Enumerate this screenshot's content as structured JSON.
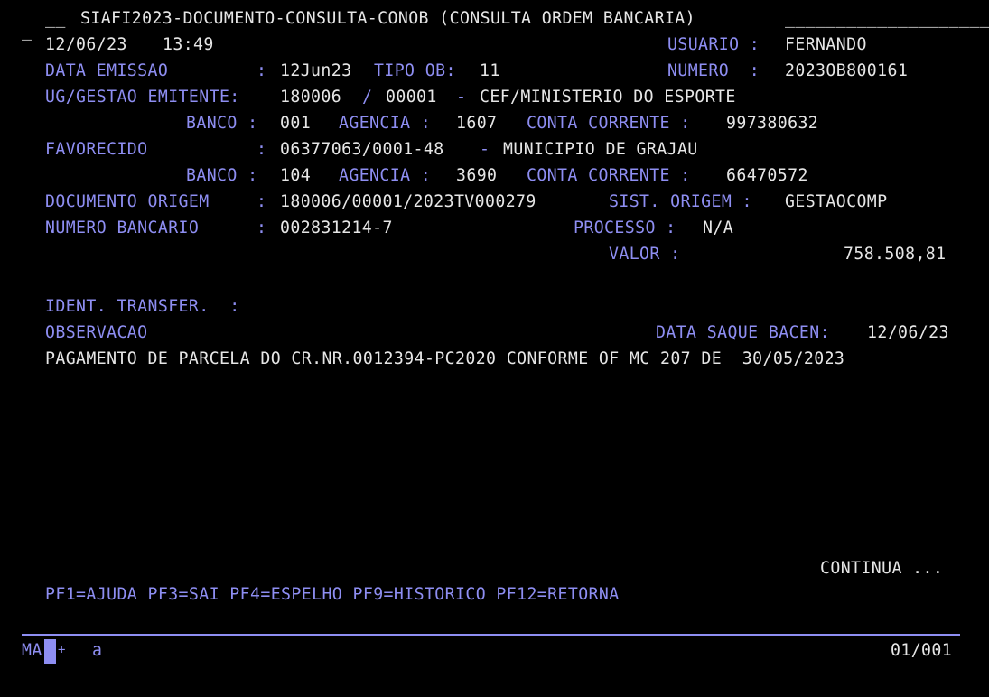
{
  "header": {
    "cursor_mark": "_",
    "prefix": "__",
    "title": "SIAFI2023-DOCUMENTO-CONSULTA-CONOB (CONSULTA ORDEM BANCARIA)",
    "fill": "____________________"
  },
  "session": {
    "date": "12/06/23",
    "time": "13:49",
    "usuario_label": "USUARIO :",
    "usuario_value": "FERNANDO"
  },
  "labels": {
    "data_emissao": "DATA EMISSAO",
    "colon": ":",
    "tipo_ob": "TIPO OB:",
    "numero": "NUMERO  :",
    "ug_gestao": "UG/GESTAO EMITENTE:",
    "slash": "/",
    "dash": "-",
    "banco": "BANCO :",
    "agencia": "AGENCIA :",
    "conta_corrente": "CONTA CORRENTE :",
    "favorecido": "FAVORECIDO",
    "documento_origem": "DOCUMENTO ORIGEM",
    "sist_origem": "SIST. ORIGEM :",
    "numero_bancario": "NUMERO BANCARIO",
    "processo": "PROCESSO :",
    "valor": "VALOR :",
    "ident_transfer": "IDENT. TRANSFER.  :",
    "observacao": "OBSERVACAO",
    "data_saque": "DATA SAQUE BACEN:"
  },
  "values": {
    "data_emissao": "12Jun23",
    "tipo_ob": "11",
    "numero": "2023OB800161",
    "ug": "180006",
    "gestao": "00001",
    "ug_nome": "CEF/MINISTERIO DO ESPORTE",
    "banco_emit": "001",
    "agencia_emit": "1607",
    "conta_emit": "997380632",
    "favorecido_cnpj": "06377063/0001-48",
    "favorecido_nome": "MUNICIPIO DE GRAJAU",
    "banco_fav": "104",
    "agencia_fav": "3690",
    "conta_fav": "66470572",
    "documento_origem": "180006/00001/2023TV000279",
    "sist_origem": "GESTAOCOMP",
    "numero_bancario": "002831214-7",
    "processo": "N/A",
    "valor": "758.508,81",
    "data_saque": "12/06/23",
    "observacao_text": "PAGAMENTO DE PARCELA DO CR.NR.0012394-PC2020 CONFORME OF MC 207 DE  30/05/2023"
  },
  "footer": {
    "continua": "CONTINUA ...",
    "pf_keys": "PF1=AJUDA PF3=SAI PF4=ESPELHO PF9=HISTORICO PF12=RETORNA"
  },
  "status_bar": {
    "ma": "MA",
    "plus": "+",
    "a": "a",
    "page": "01/001"
  },
  "colors": {
    "background": "#000000",
    "label_blue": "#8e8ef2",
    "value_white": "#e6e6e6"
  }
}
